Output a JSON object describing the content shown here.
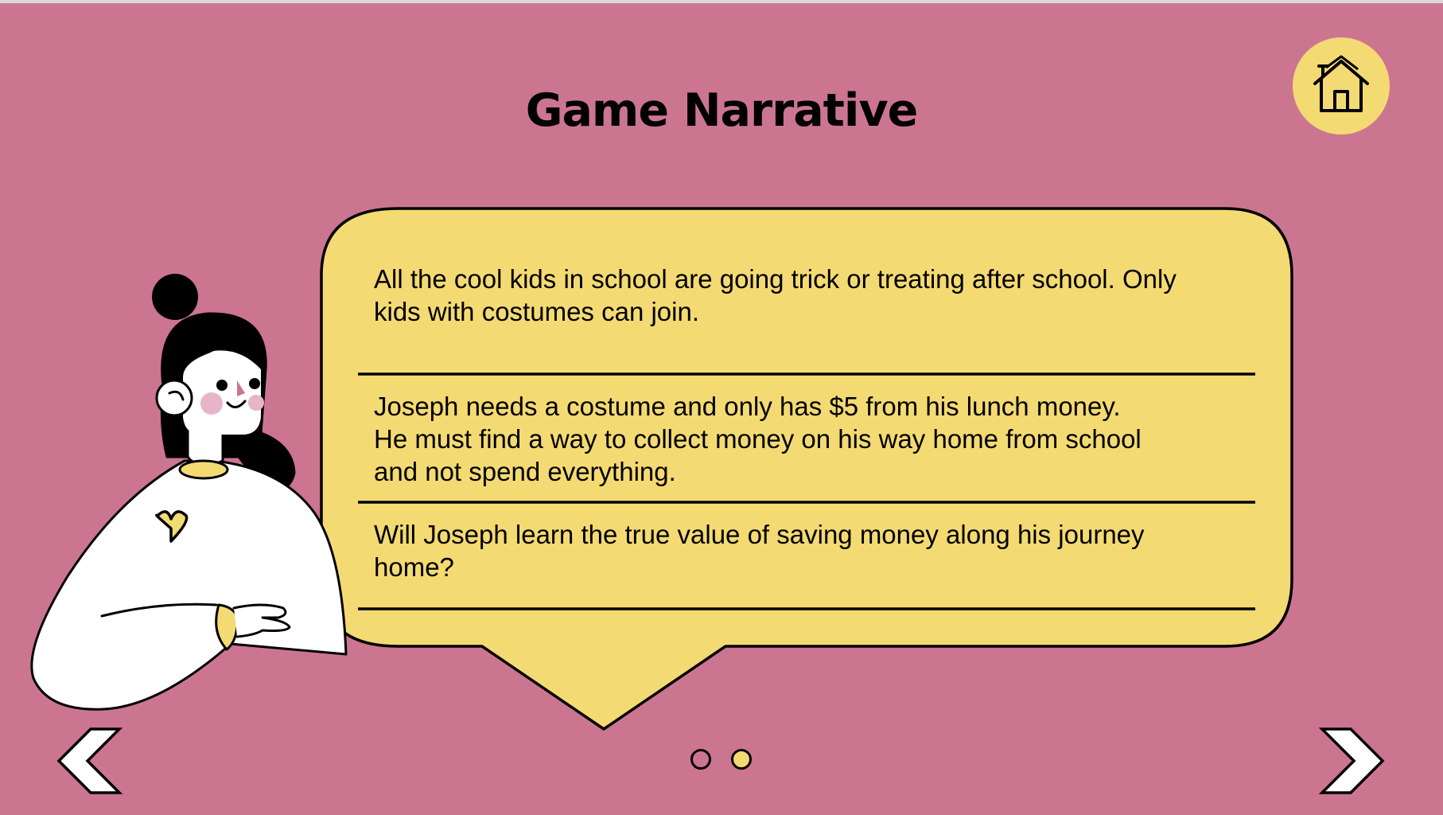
{
  "slide": {
    "title": "Game Narrative",
    "paragraphs": [
      {
        "line1": "All the cool kids in school are going trick or treating after school. Only",
        "line2": "kids with costumes can join."
      },
      {
        "line1": "Joseph needs a costume and only has $5 from his lunch money.",
        "line2": "He must find a way to collect money on his way home from school",
        "line3": "and not spend everything."
      },
      {
        "line1": "Will Joseph learn the true value of saving money along his journey",
        "line2": "home?"
      }
    ]
  },
  "navigation": {
    "home_icon": "house-icon",
    "prev_icon": "chevron-left-icon",
    "next_icon": "chevron-right-icon",
    "page_dots": [
      {
        "state": "inactive"
      },
      {
        "state": "active"
      }
    ]
  },
  "colors": {
    "background": "#cc7591",
    "bubble": "#f4da72",
    "text": "#000000"
  }
}
